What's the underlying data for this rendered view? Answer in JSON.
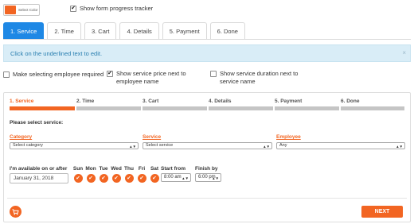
{
  "toolbar": {
    "color_button_label": "Select Color",
    "tracker_label": "Show form progress tracker",
    "tracker_checked": true
  },
  "tabs": [
    {
      "label": "1. Service",
      "active": true
    },
    {
      "label": "2. Time"
    },
    {
      "label": "3. Cart"
    },
    {
      "label": "4. Details"
    },
    {
      "label": "5. Payment"
    },
    {
      "label": "6. Done"
    }
  ],
  "alert": {
    "text": "Click on the underlined text to edit.",
    "close": "×"
  },
  "options": {
    "employee_required": "Make selecting employee required",
    "show_price": "Show service price next to employee name",
    "show_duration": "Show service duration next to service name"
  },
  "steps": [
    "1. Service",
    "2. Time",
    "3. Cart",
    "4. Details",
    "5. Payment",
    "6. Done"
  ],
  "form": {
    "section_title": "Please select service:",
    "category_label": "Category",
    "category_value": "Select category",
    "service_label": "Service",
    "service_value": "Select service",
    "employee_label": "Employee",
    "employee_value": "Any",
    "available_label": "I'm available on or after",
    "date_value": "January 31, 2018",
    "days": [
      "Sun",
      "Mon",
      "Tue",
      "Wed",
      "Thu",
      "Fri",
      "Sat"
    ],
    "start_label": "Start from",
    "start_value": "8:00 am",
    "finish_label": "Finish by",
    "finish_value": "6:00 pm"
  },
  "footer": {
    "next_label": "NEXT"
  },
  "colors": {
    "accent": "#f26522",
    "tab_active": "#1e88e5",
    "alert_bg": "#d9edf7",
    "alert_text": "#2a7fb0"
  },
  "icons": {
    "cart": "cart-icon",
    "check": "check-icon",
    "close": "close-icon",
    "dropdown": "chevron-down-icon"
  }
}
